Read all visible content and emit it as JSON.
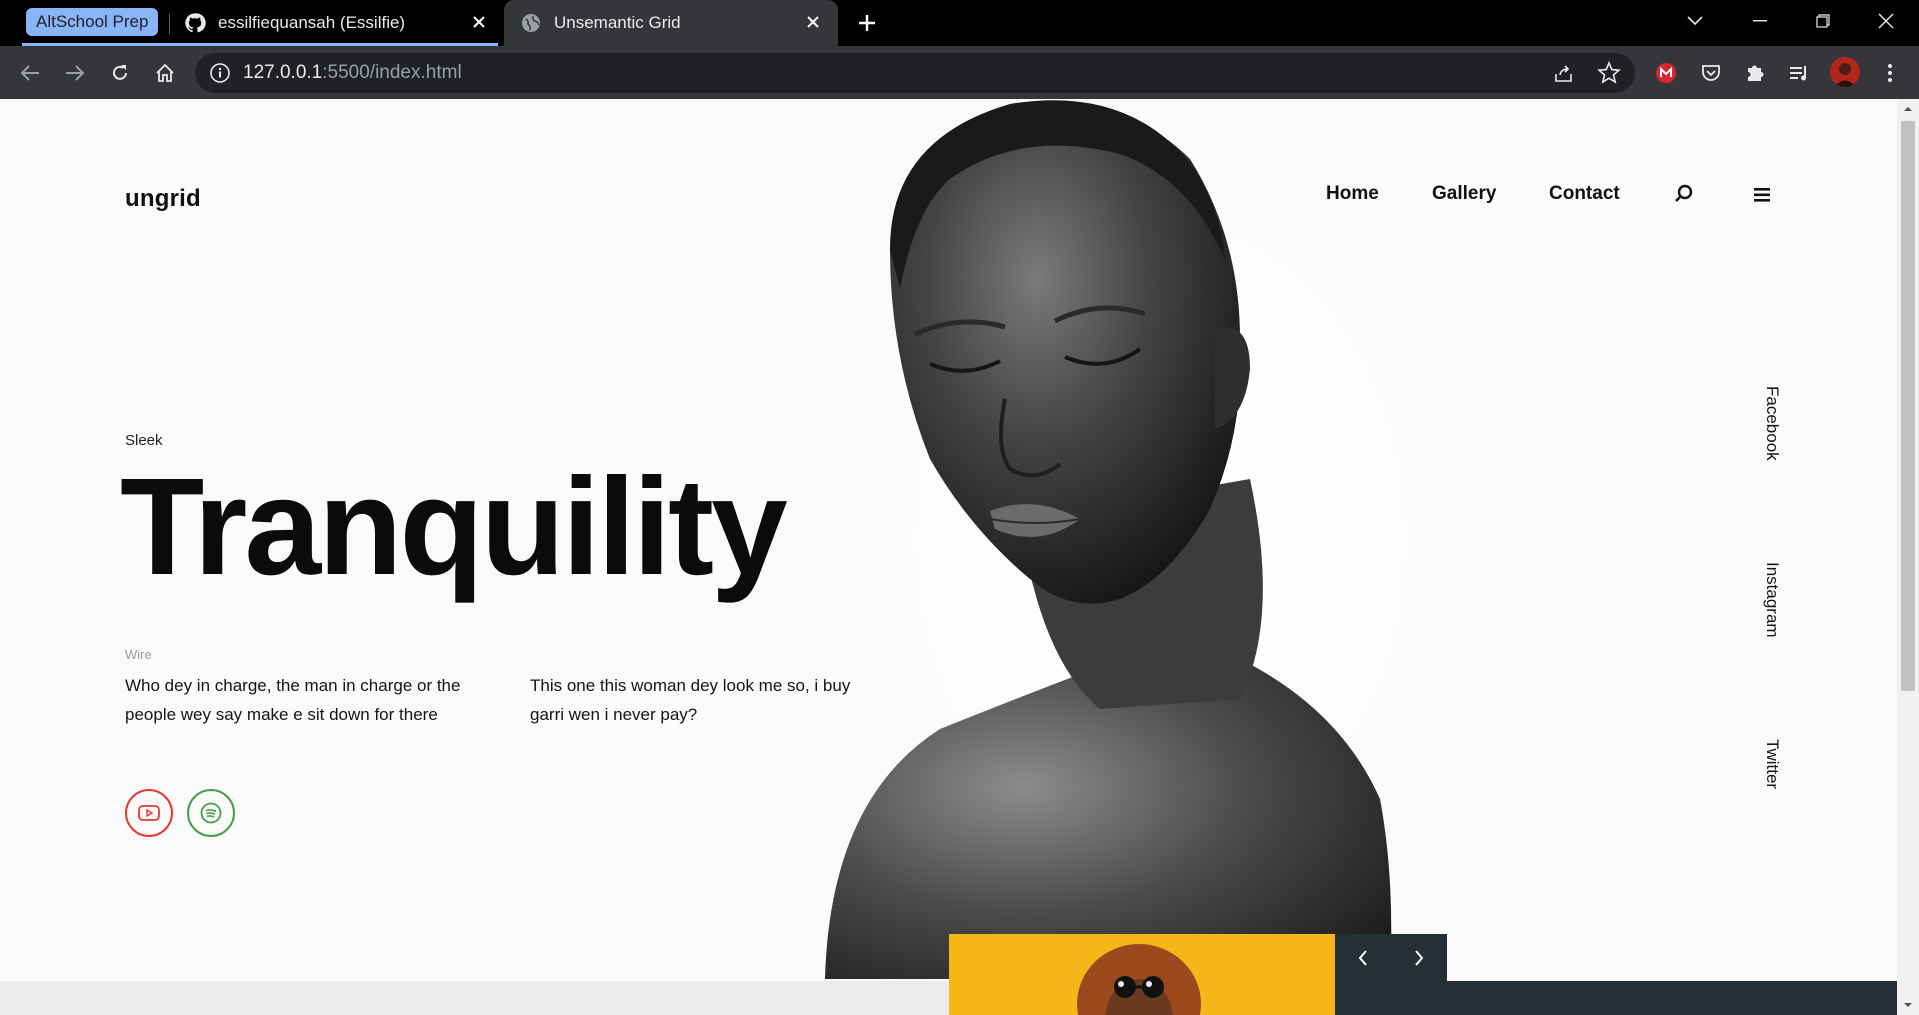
{
  "browser": {
    "tab_group_label": "AltSchool Prep",
    "tabs": [
      {
        "title": "essilfiequansah (Essilfie)",
        "favicon": "github-icon"
      },
      {
        "title": "Unsemantic Grid",
        "favicon": "globe-icon",
        "active": true
      }
    ],
    "url_host": "127.0.0.1",
    "url_path": ":5500/index.html",
    "accent_color": "#8ab4f8"
  },
  "page": {
    "logo": "ungrid",
    "nav": {
      "home": "Home",
      "gallery": "Gallery",
      "contact": "Contact"
    },
    "hero": {
      "eyebrow": "Sleek",
      "headline": "Tranquility",
      "label": "Wire",
      "paragraph_1": "Who dey in charge, the man in charge or the people wey say make e sit down for there",
      "paragraph_2": "This one this woman dey look me so, i buy garri wen i never pay?"
    },
    "social": {
      "facebook": "Facebook",
      "instagram": "Instagram",
      "twitter": "Twitter"
    },
    "colors": {
      "youtube": "#e53935",
      "spotify": "#43a047",
      "slider_bg": "#253035",
      "thumb_bg": "#f7b718"
    }
  }
}
